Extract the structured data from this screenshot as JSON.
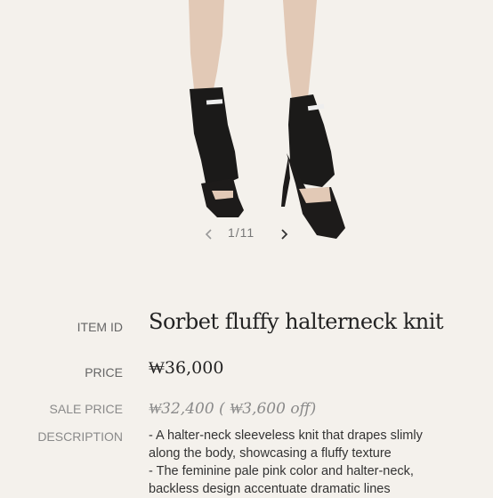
{
  "gallery": {
    "counter": "1/11",
    "prev_icon": "chevron-left-icon",
    "next_icon": "chevron-right-icon"
  },
  "product": {
    "item_id_label": "ITEM ID",
    "name": "Sorbet fluffy halterneck knit",
    "price_label": "PRICE",
    "price": "₩36,000",
    "sale_price_label": "SALE PRICE",
    "sale_price": "₩32,400 ( ₩3,600 off)",
    "description_label": "DESCRIPTION",
    "description_lines": [
      "- A halter-neck sleeveless knit that drapes slimly",
      "along the body, showcasing a fluffy texture",
      "- The feminine pale pink color and halter-neck,",
      "backless design accentuate dramatic lines"
    ]
  },
  "colors": {
    "background": "#f4f1ec",
    "text": "#222222",
    "muted": "#8a8a8a"
  }
}
